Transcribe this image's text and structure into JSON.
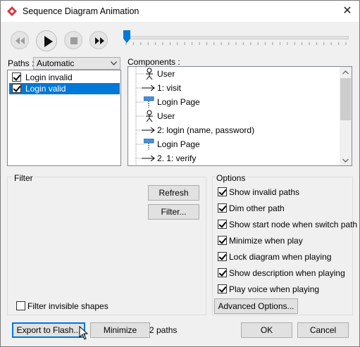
{
  "window": {
    "title": "Sequence Diagram Animation",
    "close_glyph": "✕"
  },
  "player": {
    "buttons": [
      {
        "name": "rewind-button",
        "icon": "rewind-icon"
      },
      {
        "name": "play-button",
        "icon": "play-icon"
      },
      {
        "name": "stop-button",
        "icon": "stop-icon"
      },
      {
        "name": "fast-forward-button",
        "icon": "fast-forward-icon"
      }
    ],
    "progress": 0
  },
  "paths": {
    "label": "Paths :",
    "selected": "Automatic",
    "items": [
      {
        "label": "Login invalid",
        "checked": true,
        "selected": false
      },
      {
        "label": "Login valid",
        "checked": true,
        "selected": true
      }
    ]
  },
  "components": {
    "label": "Components :",
    "items": [
      {
        "label": "User",
        "icon": "actor-icon"
      },
      {
        "label": "1: visit",
        "icon": "message-arrow-icon"
      },
      {
        "label": "Login Page",
        "icon": "lifeline-icon"
      },
      {
        "label": "User",
        "icon": "actor-icon"
      },
      {
        "label": "2: login (name, password)",
        "icon": "message-arrow-icon"
      },
      {
        "label": "Login Page",
        "icon": "lifeline-icon"
      },
      {
        "label": "2. 1: verify",
        "icon": "message-arrow-icon"
      }
    ]
  },
  "filter": {
    "label": "Filter",
    "refresh_label": "Refresh",
    "filter_label": "Filter...",
    "invisible_label": "Filter invisible shapes",
    "invisible_checked": false
  },
  "options": {
    "label": "Options",
    "items": [
      {
        "label": "Show invalid paths",
        "checked": true
      },
      {
        "label": "Dim other path",
        "checked": true
      },
      {
        "label": "Show start node when switch path",
        "checked": true
      },
      {
        "label": "Minimize when play",
        "checked": true
      },
      {
        "label": "Lock diagram when playing",
        "checked": true
      },
      {
        "label": "Show description when playing",
        "checked": true
      },
      {
        "label": "Play voice when playing",
        "checked": true
      }
    ],
    "advanced_label": "Advanced Options..."
  },
  "footer": {
    "export_label": "Export to Flash...",
    "minimize_label": "Minimize",
    "path_count": "2 paths",
    "ok_label": "OK",
    "cancel_label": "Cancel"
  },
  "colors": {
    "accent": "#0078d7",
    "brand_red": "#d9363e"
  }
}
